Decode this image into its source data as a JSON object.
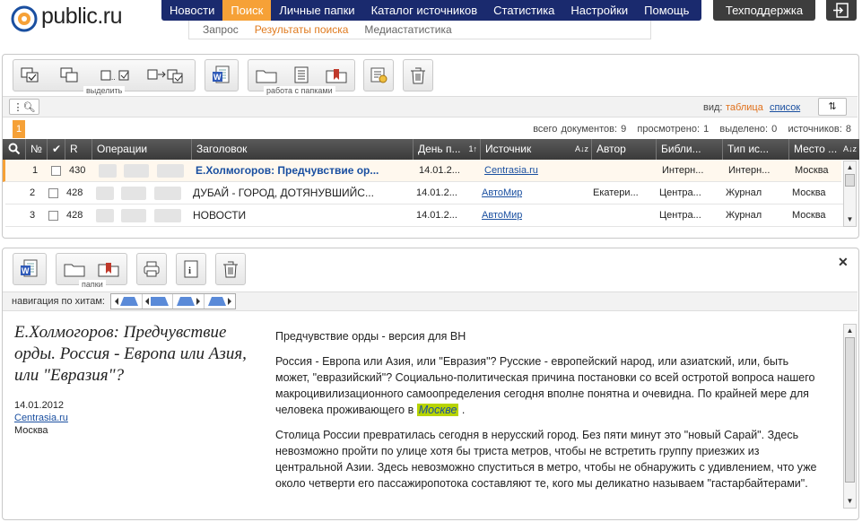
{
  "brand": {
    "logo_text": "public.ru"
  },
  "nav": {
    "main": [
      "Новости",
      "Поиск",
      "Личные папки",
      "Каталог источников",
      "Статистика",
      "Настройки",
      "Помощь"
    ],
    "active_index": 1,
    "sub": [
      "Запрос",
      "Результаты поиска",
      "Медиастатистика"
    ],
    "sub_active_index": 1,
    "support": "Техподдержка"
  },
  "toolbar": {
    "select_group_label": "выделить",
    "folders_group_label": "работа с папками"
  },
  "view": {
    "label": "вид:",
    "table": "таблица",
    "list": "список"
  },
  "stats": {
    "page": "1",
    "total_label": "всего документов:",
    "total": "9",
    "viewed_label": "просмотрено:",
    "viewed": "1",
    "selected_label": "выделено:",
    "selected": "0",
    "sources_label": "источников:",
    "sources": "8"
  },
  "table": {
    "headers": {
      "num": "№",
      "check": "✔",
      "r": "R",
      "ops": "Операции",
      "title": "Заголовок",
      "date": "День п...",
      "date_sort": "1↑",
      "source": "Источник",
      "source_sort": "A↓z",
      "author": "Автор",
      "library": "Библи...",
      "type": "Тип ис...",
      "place": "Место ...",
      "place_sort": "A↓z"
    },
    "rows": [
      {
        "num": "1",
        "r": "430",
        "title": "Е.Холмогоров: Предчувствие ор...",
        "date": "14.01.2...",
        "source": "Centrasia.ru",
        "author": "",
        "library": "Интерн...",
        "type": "Интерн...",
        "place": "Москва"
      },
      {
        "num": "2",
        "r": "428",
        "title": "ДУБАЙ - ГОРОД, ДОТЯНУВШИЙС...",
        "date": "14.01.2...",
        "source": "АвтоМир",
        "author": "Екатери...",
        "library": "Центра...",
        "type": "Журнал",
        "place": "Москва"
      },
      {
        "num": "3",
        "r": "428",
        "title": "НОВОСТИ",
        "date": "14.01.2...",
        "source": "АвтоМир",
        "author": "",
        "library": "Центра...",
        "type": "Журнал",
        "place": "Москва"
      }
    ]
  },
  "doc_toolbar": {
    "folders_label": "папки"
  },
  "hit_nav": {
    "label": "навигация по хитам:"
  },
  "document": {
    "title": "Е.Холмогоров: Предчувствие орды. Россия - Европа или Азия, или \"Евразия\"?",
    "date": "14.01.2012",
    "source": "Centrasia.ru",
    "city": "Москва",
    "lead": "Предчувствие орды - версия для ВН",
    "p1_before": "Россия - Европа или Азия, или \"Евразия\"? Русские - европейский народ, или азиатский, или, быть может, \"евразийский\"? Социально-политическая причина постановки со всей остротой вопроса нашего макроцивилизационного самоопределения сегодня вполне понятна и очевидна. По крайней мере для человека проживающего в",
    "p1_highlight": "Москве",
    "p1_after": ".",
    "p2": "Столица России превратилась сегодня в нерусский город. Без пяти минут это \"новый Сарай\". Здесь невозможно пройти по улице хотя бы триста метров, чтобы не встретить группу приезжих из центральной Азии. Здесь невозможно спуститься в метро, чтобы не обнаружить с удивлением, что уже около четверти его пассажиропотока составляют те, кого мы деликатно называем \"гастарбайтерами\"."
  },
  "colors": {
    "nav_bg": "#1a2a6e",
    "accent": "#f6a137",
    "link": "#1a4fa0",
    "highlight": "#b8d400"
  }
}
